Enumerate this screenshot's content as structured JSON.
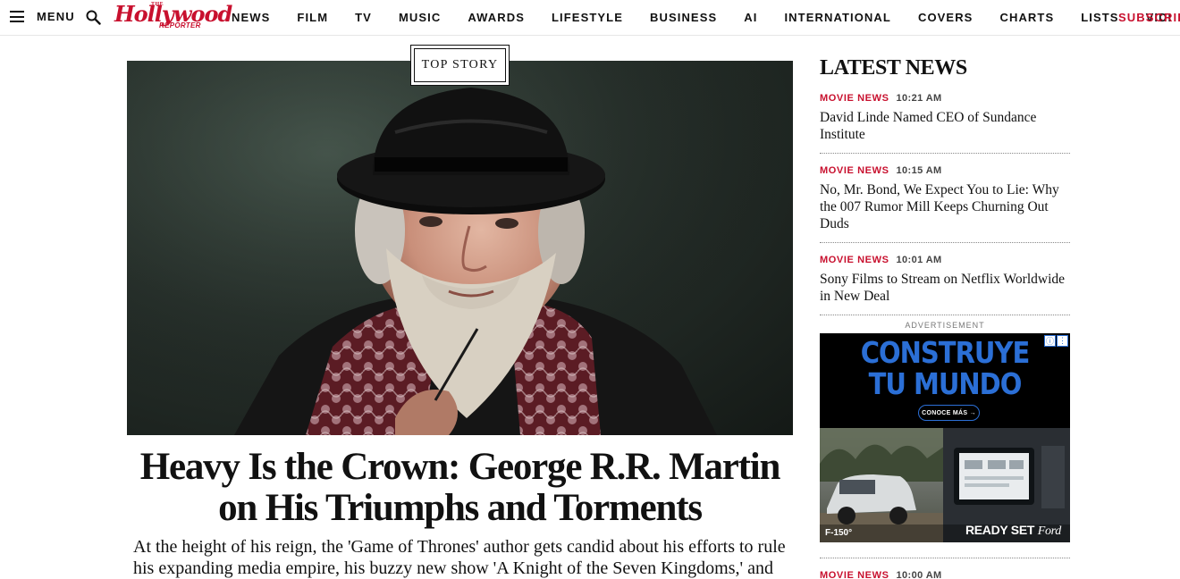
{
  "nav": {
    "menu_label": "MENU",
    "logo": {
      "the": "THE",
      "main": "Hollywood",
      "sub": "REPORTER"
    },
    "links": [
      "NEWS",
      "FILM",
      "TV",
      "MUSIC",
      "AWARDS",
      "LIFESTYLE",
      "BUSINESS",
      "AI",
      "INTERNATIONAL",
      "COVERS",
      "CHARTS",
      "LISTS",
      "VIDI"
    ],
    "subscribe": "SUBSCRIB"
  },
  "hero": {
    "badge": "TOP STORY",
    "headline": "Heavy Is the Crown: George R.R. Martin on His Triumphs and Torments",
    "dek": "At the height of his reign, the 'Game of Thrones' author gets candid about his efforts to rule his expanding media empire, his buzzy new show 'A Knight of the Seven Kingdoms,' and the"
  },
  "sidebar": {
    "title": "LATEST NEWS",
    "items": [
      {
        "category": "MOVIE NEWS",
        "time": "10:21 AM",
        "title": "David Linde Named CEO of Sundance Institute"
      },
      {
        "category": "MOVIE NEWS",
        "time": "10:15 AM",
        "title": "No, Mr. Bond, We Expect You to Lie: Why the 007 Rumor Mill Keeps Churning Out Duds"
      },
      {
        "category": "MOVIE NEWS",
        "time": "10:01 AM",
        "title": "Sony Films to Stream on Netflix Worldwide in New Deal"
      }
    ],
    "ad_label": "ADVERTISEMENT",
    "ad": {
      "line1": "CONSTRUYE",
      "line2": "TU MUNDO",
      "cta": "CONOCE MÁS →",
      "model": "F-150°",
      "tagline": "READY SET",
      "brand": "Ford"
    },
    "next_item": {
      "category": "MOVIE NEWS",
      "time": "10:00 AM"
    }
  },
  "colors": {
    "accent": "#c8102e",
    "text": "#111111",
    "ad_blue": "#2b6fd6"
  }
}
